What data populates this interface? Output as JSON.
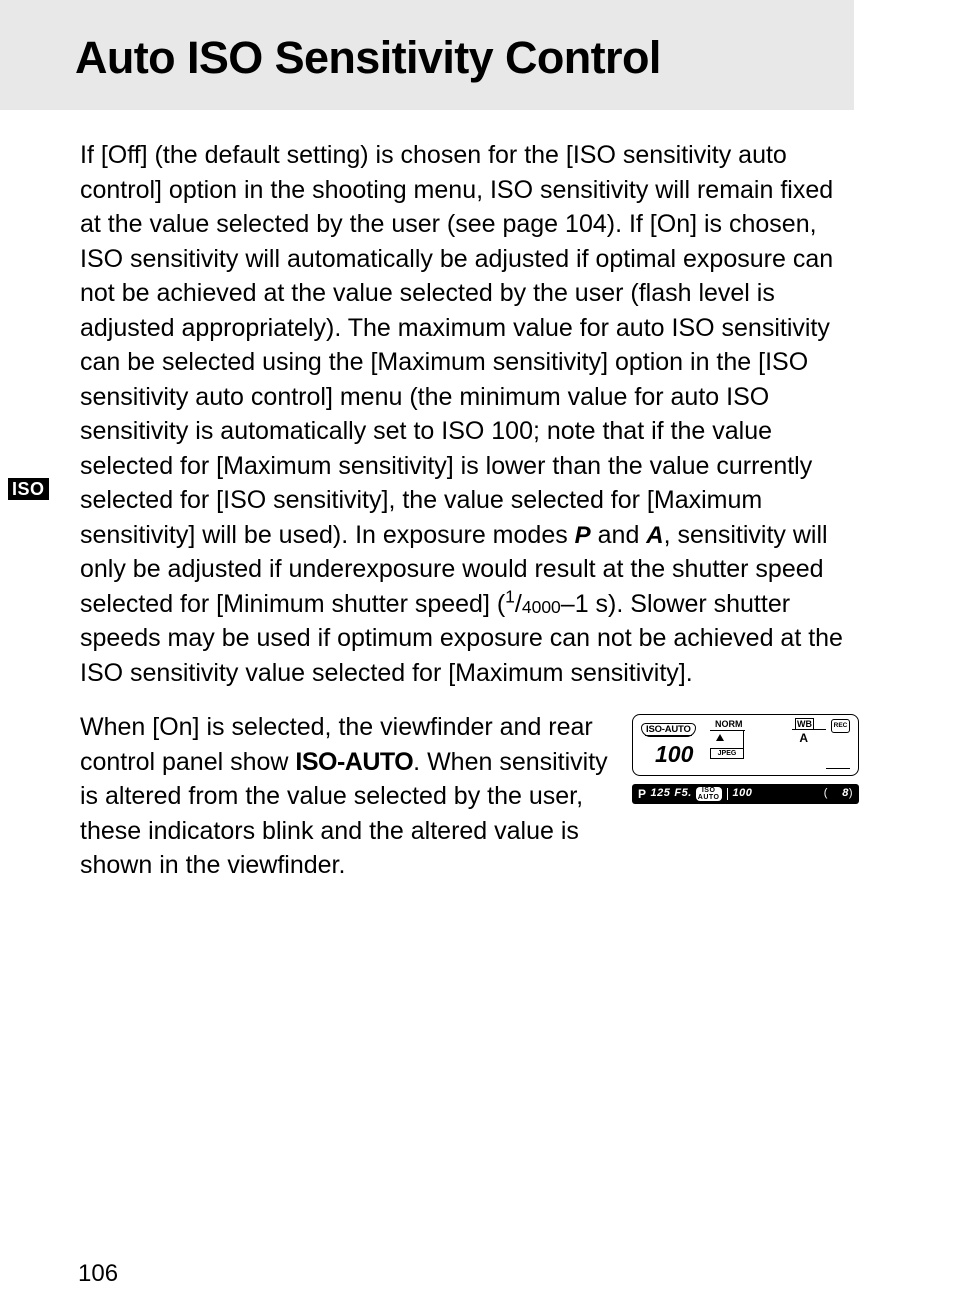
{
  "header": {
    "title": "Auto ISO Sensitivity Control"
  },
  "tab": {
    "label": "ISO"
  },
  "body": {
    "p1_a": "If [Off] (the default setting) is chosen for the [ISO sensitivity auto control] option in the shooting menu, ISO sensitivity will remain fixed at the value selected by the user (see page 104).  If [On] is chosen, ISO sensitivity will automatically be adjusted if optimal exposure can not be achieved at the value selected by the user (flash level is adjusted appropriately).  The maximum value for auto ISO sensitivity can be selected using the [Maximum sensitivity] option in the [ISO sensitivity auto control] menu (the minimum value for auto ISO sensitivity is automatically set to ISO 100; note that if the value selected for [Maximum sensitivity] is lower than the value currently selected for [ISO sensitivity], the value selected for [Maximum sensitivity] will be used).  In exposure modes ",
    "mode_p": "P",
    "p1_b": " and ",
    "mode_a": "A",
    "p1_c": ", sensitivity will only be adjusted if underexposure would result at the shutter speed selected for [Minimum shutter speed] (",
    "frac_num": "1",
    "frac_sep": "/",
    "frac_den": "4000",
    "p1_d": "–1 s).  Slower shutter speeds may be used if optimum exposure can not be achieved at the ISO sensitivity value selected for [Maximum sensitivity].",
    "p2_a": "When [On] is selected, the viewfinder and rear control panel show ",
    "iso_auto_label": "ISO-AUTO",
    "p2_b": ".  When sensitivity is altered from the value selected by the user, these indicators blink and the altered value is shown in the viewfinder."
  },
  "lcd": {
    "iso_auto": "ISO-AUTO",
    "iso_value": "100",
    "norm": "NORM",
    "jpeg": "JPEG",
    "wb": "WB",
    "wb_mode": "A",
    "rec": "REC"
  },
  "viewfinder": {
    "mode": "P",
    "shutter": "125",
    "aperture": "F5.",
    "iso_top": "ISO",
    "iso_bot": "AUTO",
    "iso_value": "100",
    "count": "8"
  },
  "page_number": "106"
}
